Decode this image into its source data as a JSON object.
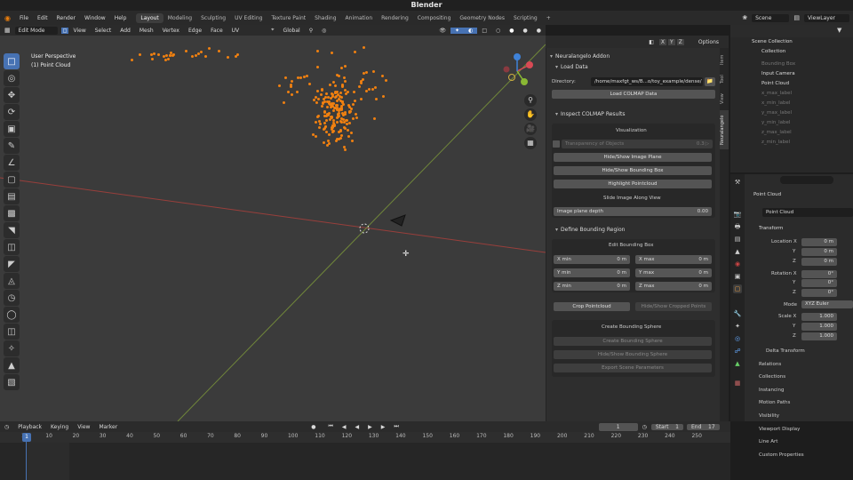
{
  "app_title": "Blender",
  "menu": {
    "items": [
      "File",
      "Edit",
      "Render",
      "Window",
      "Help"
    ],
    "workspaces": [
      "Layout",
      "Modeling",
      "Sculpting",
      "UV Editing",
      "Texture Paint",
      "Shading",
      "Animation",
      "Rendering",
      "Compositing",
      "Geometry Nodes",
      "Scripting"
    ],
    "active_workspace": "Layout",
    "add_tab": "+",
    "scene_label": "Scene",
    "viewlayer_label": "ViewLayer"
  },
  "viewport_header": {
    "mode": "Edit Mode",
    "menus": [
      "View",
      "Select",
      "Add",
      "Mesh",
      "Vertex",
      "Edge",
      "Face",
      "UV"
    ],
    "transform_orientation": "Global",
    "options": "Options",
    "axes": [
      "X",
      "Y",
      "Z"
    ]
  },
  "viewport": {
    "view_name": "User Perspective",
    "object_name": "(1) Point Cloud",
    "gizmo_axes": [
      "X",
      "Y",
      "Z"
    ]
  },
  "npanel": {
    "addon_title": "Neuralangelo Addon",
    "load_data": {
      "title": "Load Data",
      "directory_label": "Directory:",
      "directory_value": "/home/maxfgt_ws/B...o/toy_example/dense/",
      "load_button": "Load COLMAP Data"
    },
    "inspect": {
      "title": "Inspect COLMAP Results",
      "visualization": "Visualization",
      "transparency_label": "Transparency of Objects",
      "transparency_value": "0.3 ▷",
      "hide_image_plane": "Hide/Show Image Plane",
      "hide_bbox": "Hide/Show Bounding Box",
      "highlight": "Highlight Pointcloud",
      "slide_title": "Slide Image Along View",
      "image_plane_depth_label": "Image plane depth",
      "image_plane_depth_value": "0.00"
    },
    "bbox": {
      "title": "Define Bounding Region",
      "edit_title": "Edit Bounding Box",
      "x_min": "X min",
      "x_min_value": "0 m",
      "x_max": "X max",
      "x_max_value": "0 m",
      "y_min": "Y min",
      "y_min_value": "0 m",
      "y_max": "Y max",
      "y_max_value": "0 m",
      "z_min": "Z min",
      "z_min_value": "0 m",
      "z_max": "Z max",
      "z_max_value": "0 m",
      "crop": "Crop Pointcloud",
      "hide_cropped": "Hide/Show Cropped Points"
    },
    "sphere": {
      "title": "Create Bounding Sphere",
      "create": "Create Bounding Sphere",
      "hide": "Hide/Show Bounding Sphere",
      "export": "Export Scene Parameters"
    },
    "tabs": [
      "Item",
      "Tool",
      "View",
      "Neuralangelo"
    ]
  },
  "outliner": {
    "scene_collection": "Scene Collection",
    "collection": "Collection",
    "items": [
      {
        "name": "Bounding Box",
        "dim": true
      },
      {
        "name": "Input Camera",
        "dim": false
      },
      {
        "name": "Point Cloud",
        "dim": false
      },
      {
        "name": "x_max_label",
        "dim": true
      },
      {
        "name": "x_min_label",
        "dim": true
      },
      {
        "name": "y_max_label",
        "dim": true
      },
      {
        "name": "y_min_label",
        "dim": true
      },
      {
        "name": "z_max_label",
        "dim": true
      },
      {
        "name": "z_min_label",
        "dim": true
      }
    ]
  },
  "properties": {
    "object_name": "Point Cloud",
    "data_name": "Point Cloud",
    "transform": "Transform",
    "location_label": "Location X",
    "location": [
      "0 m",
      "0 m",
      "0 m"
    ],
    "rotation_label": "Rotation X",
    "rotation": [
      "0°",
      "0°",
      "0°"
    ],
    "mode_label": "Mode",
    "mode_value": "XYZ Euler",
    "scale_label": "Scale X",
    "scale": [
      "1.000",
      "1.000",
      "1.000"
    ],
    "y": "Y",
    "z": "Z",
    "sections": [
      "Delta Transform",
      "Relations",
      "Collections",
      "Instancing",
      "Motion Paths",
      "Visibility",
      "Viewport Display",
      "Line Art",
      "Custom Properties"
    ]
  },
  "timeline": {
    "menus": [
      "Playback",
      "Keying",
      "View",
      "Marker"
    ],
    "current_frame": "1",
    "start_label": "Start",
    "start_value": "1",
    "end_label": "End",
    "end_value": "17",
    "ticks": [
      "1",
      "10",
      "20",
      "30",
      "40",
      "50",
      "60",
      "70",
      "80",
      "90",
      "100",
      "110",
      "120",
      "130",
      "140",
      "150",
      "160",
      "170",
      "180",
      "190",
      "200",
      "210",
      "220",
      "230",
      "240",
      "250"
    ]
  },
  "colors": {
    "accent": "#4772b3",
    "points": "#f08010",
    "x_axis": "#b0403c",
    "y_axis": "#7e9a3a"
  }
}
